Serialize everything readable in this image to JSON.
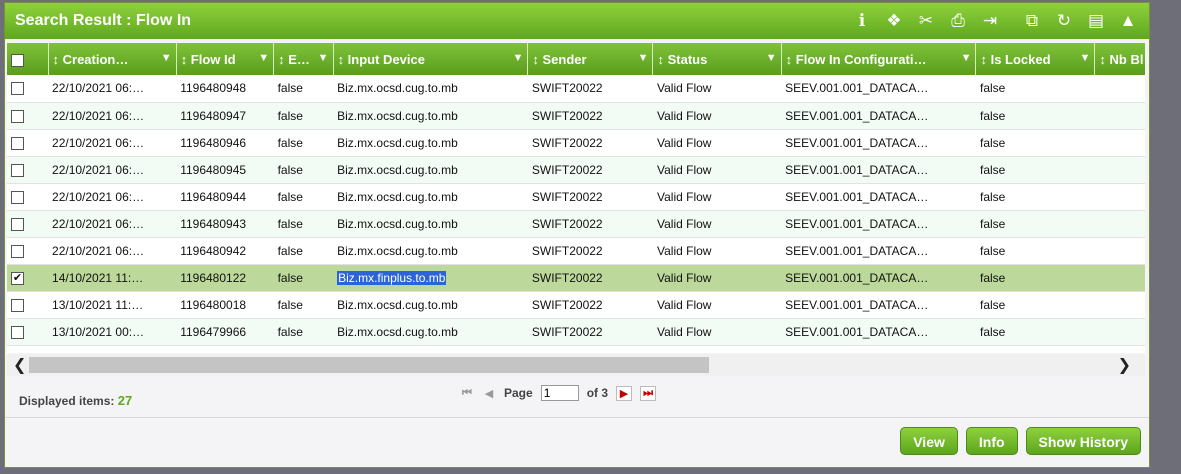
{
  "title": "Search Result : Flow In",
  "toolbar_icons": [
    "info-icon",
    "chart-icon",
    "link-icon",
    "print-icon",
    "export-icon",
    "clipboard-icon",
    "refresh-icon",
    "save-icon",
    "collapse-icon"
  ],
  "toolbar_glyphs": [
    "ℹ",
    "❖",
    "✂",
    "⎙",
    "⇥",
    "⧉",
    "↻",
    "▤",
    "▲"
  ],
  "columns": [
    {
      "label": "↕ Creation…",
      "filter": true,
      "w": 125
    },
    {
      "label": "↕ Flow Id",
      "filter": true,
      "w": 95
    },
    {
      "label": "↕ E…",
      "filter": true,
      "w": 58
    },
    {
      "label": "↕ Input Device",
      "filter": true,
      "w": 190
    },
    {
      "label": "↕ Sender",
      "filter": true,
      "w": 122
    },
    {
      "label": "↕ Status",
      "filter": true,
      "w": 125
    },
    {
      "label": "↕ Flow In Configurati…",
      "filter": true,
      "w": 190
    },
    {
      "label": "↕ Is Locked",
      "filter": true,
      "w": 116
    },
    {
      "label": "↕ Nb Bl",
      "filter": false,
      "w": 60
    }
  ],
  "rows": [
    {
      "checked": false,
      "cells": [
        "22/10/2021 06:…",
        "1196480948",
        "false",
        "Biz.mx.ocsd.cug.to.mb",
        "SWIFT20022",
        "Valid Flow",
        "SEEV.001.001_DATACA…",
        "false",
        ""
      ]
    },
    {
      "checked": false,
      "cells": [
        "22/10/2021 06:…",
        "1196480947",
        "false",
        "Biz.mx.ocsd.cug.to.mb",
        "SWIFT20022",
        "Valid Flow",
        "SEEV.001.001_DATACA…",
        "false",
        ""
      ]
    },
    {
      "checked": false,
      "cells": [
        "22/10/2021 06:…",
        "1196480946",
        "false",
        "Biz.mx.ocsd.cug.to.mb",
        "SWIFT20022",
        "Valid Flow",
        "SEEV.001.001_DATACA…",
        "false",
        ""
      ]
    },
    {
      "checked": false,
      "cells": [
        "22/10/2021 06:…",
        "1196480945",
        "false",
        "Biz.mx.ocsd.cug.to.mb",
        "SWIFT20022",
        "Valid Flow",
        "SEEV.001.001_DATACA…",
        "false",
        ""
      ]
    },
    {
      "checked": false,
      "cells": [
        "22/10/2021 06:…",
        "1196480944",
        "false",
        "Biz.mx.ocsd.cug.to.mb",
        "SWIFT20022",
        "Valid Flow",
        "SEEV.001.001_DATACA…",
        "false",
        ""
      ]
    },
    {
      "checked": false,
      "cells": [
        "22/10/2021 06:…",
        "1196480943",
        "false",
        "Biz.mx.ocsd.cug.to.mb",
        "SWIFT20022",
        "Valid Flow",
        "SEEV.001.001_DATACA…",
        "false",
        ""
      ]
    },
    {
      "checked": false,
      "cells": [
        "22/10/2021 06:…",
        "1196480942",
        "false",
        "Biz.mx.ocsd.cug.to.mb",
        "SWIFT20022",
        "Valid Flow",
        "SEEV.001.001_DATACA…",
        "false",
        ""
      ]
    },
    {
      "checked": true,
      "selected": true,
      "highlight_col": 3,
      "cells": [
        "14/10/2021 11:…",
        "1196480122",
        "false",
        "Biz.mx.finplus.to.mb",
        "SWIFT20022",
        "Valid Flow",
        "SEEV.001.001_DATACA…",
        "false",
        ""
      ]
    },
    {
      "checked": false,
      "cells": [
        "13/10/2021 11:…",
        "1196480018",
        "false",
        "Biz.mx.ocsd.cug.to.mb",
        "SWIFT20022",
        "Valid Flow",
        "SEEV.001.001_DATACA…",
        "false",
        ""
      ]
    },
    {
      "checked": false,
      "cells": [
        "13/10/2021 00:…",
        "1196479966",
        "false",
        "Biz.mx.ocsd.cug.to.mb",
        "SWIFT20022",
        "Valid Flow",
        "SEEV.001.001_DATACA…",
        "false",
        ""
      ]
    }
  ],
  "footer": {
    "displayed_label": "Displayed items:",
    "displayed_count": "27",
    "page_label": "Page",
    "page_value": "1",
    "of_label": "of 3"
  },
  "buttons": {
    "view": "View",
    "info": "Info",
    "history": "Show History"
  },
  "colors": {
    "accent": "#6fb92a",
    "selected_row": "#bcd89a",
    "highlight": "#2c63d8"
  }
}
